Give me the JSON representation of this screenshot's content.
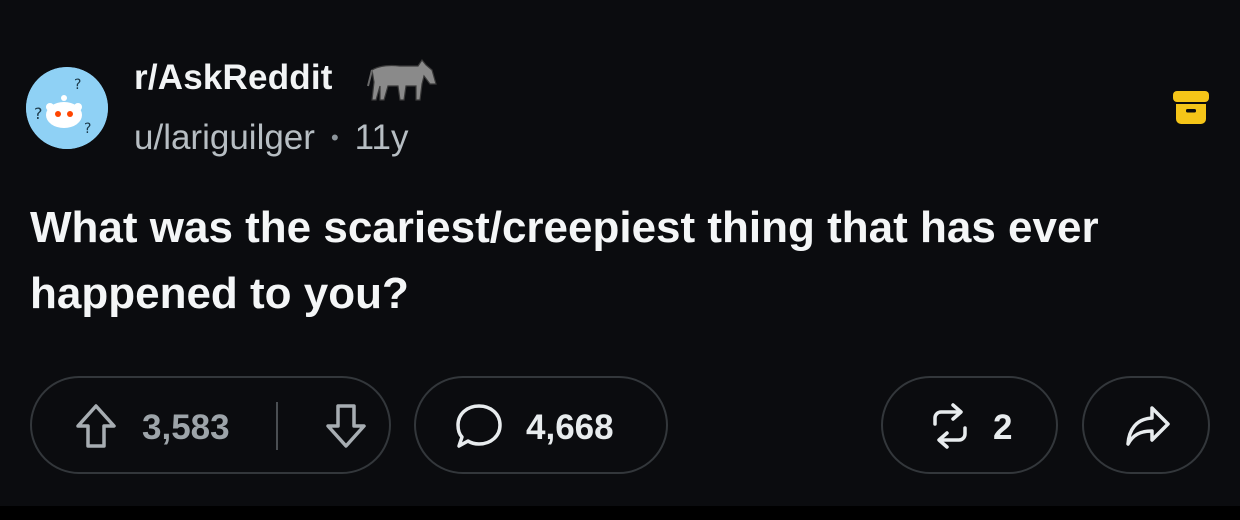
{
  "post": {
    "subreddit": "r/AskReddit",
    "author": "u/lariguilger",
    "separator": "•",
    "age": "11y",
    "title": "What was the scariest/creepiest thing that has ever happened to you?"
  },
  "actions": {
    "upvotes": "3,583",
    "comments": "4,668",
    "crossposts": "2"
  },
  "icons": {
    "avatar": "reddit-snoo-question-avatar",
    "subreddit_badge": "donkey-icon",
    "archive": "archive-icon",
    "upvote": "upvote-arrow-icon",
    "downvote": "downvote-arrow-icon",
    "comment": "comment-bubble-icon",
    "crosspost": "crosspost-icon",
    "share": "share-arrow-icon"
  },
  "colors": {
    "background": "#0b0c0f",
    "archive": "#f5c518",
    "avatar_bg": "#8fd1f5"
  }
}
